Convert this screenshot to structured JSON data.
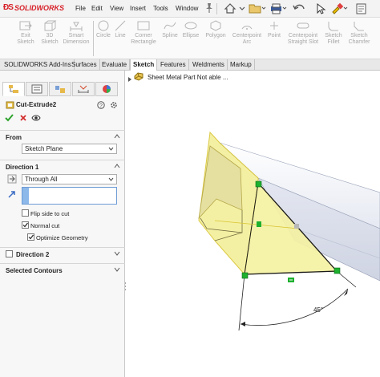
{
  "app": {
    "brand": "SOLIDWORKS",
    "menu": [
      "File",
      "Edit",
      "View",
      "Insert",
      "Tools",
      "Window"
    ]
  },
  "ribbon": {
    "commands": [
      {
        "label": "Exit\nSketch",
        "icon": "exit-sketch-icon"
      },
      {
        "label": "3D\nSketch",
        "icon": "3d-sketch-icon"
      },
      {
        "label": "Smart\nDimension",
        "icon": "smart-dimension-icon"
      },
      {
        "label": "Circle",
        "icon": "circle-icon"
      },
      {
        "label": "Line",
        "icon": "line-icon"
      },
      {
        "label": "Corner\nRectangle",
        "icon": "corner-rectangle-icon"
      },
      {
        "label": "Spline",
        "icon": "spline-icon"
      },
      {
        "label": "Ellipse",
        "icon": "ellipse-icon"
      },
      {
        "label": "Polygon",
        "icon": "polygon-icon"
      },
      {
        "label": "Centerpoint\nArc",
        "icon": "centerpoint-arc-icon"
      },
      {
        "label": "Point",
        "icon": "point-icon"
      },
      {
        "label": "Centerpoint\nStraight Slot",
        "icon": "straight-slot-icon"
      },
      {
        "label": "Sketch\nFillet",
        "icon": "sketch-fillet-icon"
      },
      {
        "label": "Sketch\nChamfer",
        "icon": "sketch-chamfer-icon"
      }
    ]
  },
  "tabs": [
    "SOLIDWORKS Add-Ins",
    "Surfaces",
    "Evaluate",
    "Sketch",
    "Features",
    "Weldments",
    "Markup"
  ],
  "active_tab": "Sketch",
  "property_manager": {
    "feature_name": "Cut-Extrude2",
    "from": {
      "title": "From",
      "value": "Sketch Plane"
    },
    "direction1": {
      "title": "Direction 1",
      "end_condition": "Through All",
      "flip_side_to_cut": {
        "label": "Flip side to cut",
        "checked": false
      },
      "normal_cut": {
        "label": "Normal cut",
        "checked": true
      },
      "optimize_geometry": {
        "label": "Optimize Geometry",
        "checked": true
      }
    },
    "direction2": {
      "title": "Direction 2",
      "checked": false
    },
    "selected_contours": {
      "title": "Selected Contours"
    }
  },
  "graphics": {
    "tree_item": "Sheet Metal Part Not able ...",
    "dimension": "45°",
    "colors": {
      "highlight_fill": "#f3ef9a",
      "highlight_edge": "#d8c431",
      "relation_green": "#1eb02e"
    }
  }
}
